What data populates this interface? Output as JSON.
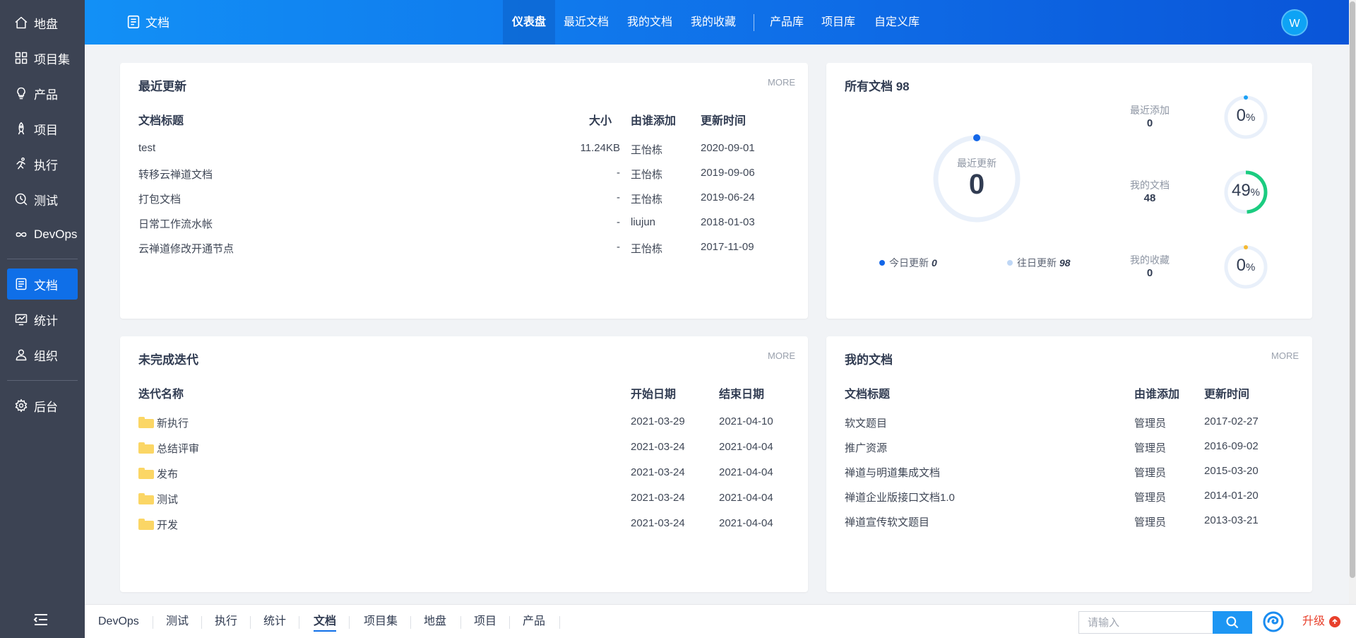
{
  "sidebar": {
    "items": [
      {
        "label": "地盘",
        "icon": "home-icon"
      },
      {
        "label": "项目集",
        "icon": "grid-icon"
      },
      {
        "label": "产品",
        "icon": "bulb-icon"
      },
      {
        "label": "项目",
        "icon": "rocket-icon"
      },
      {
        "label": "执行",
        "icon": "run-icon"
      },
      {
        "label": "测试",
        "icon": "test-icon"
      },
      {
        "label": "DevOps",
        "icon": "infinity-icon"
      },
      {
        "label": "文档",
        "icon": "doc-icon"
      },
      {
        "label": "统计",
        "icon": "chart-icon"
      },
      {
        "label": "组织",
        "icon": "user-icon"
      },
      {
        "label": "后台",
        "icon": "gear-icon"
      }
    ],
    "active": "文档"
  },
  "header": {
    "title": "文档",
    "nav": [
      "仪表盘",
      "最近文档",
      "我的文档",
      "我的收藏",
      "产品库",
      "项目库",
      "自定义库"
    ],
    "active_nav": "仪表盘",
    "avatar": "W"
  },
  "recent": {
    "title": "最近更新",
    "more": "MORE",
    "headers": {
      "title": "文档标题",
      "size": "大小",
      "added_by": "由谁添加",
      "updated": "更新时间"
    },
    "rows": [
      {
        "title": "test",
        "size": "11.24KB",
        "added_by": "王怡栋",
        "updated": "2020-09-01"
      },
      {
        "title": "转移云禅道文档",
        "size": "-",
        "added_by": "王怡栋",
        "updated": "2019-09-06"
      },
      {
        "title": "打包文档",
        "size": "-",
        "added_by": "王怡栋",
        "updated": "2019-06-24"
      },
      {
        "title": "日常工作流水帐",
        "size": "-",
        "added_by": "liujun",
        "updated": "2018-01-03"
      },
      {
        "title": "云禅道修改开通节点",
        "size": "-",
        "added_by": "王怡栋",
        "updated": "2017-11-09"
      }
    ]
  },
  "all_docs": {
    "title": "所有文档 98",
    "center_label": "最近更新",
    "center_value": "0",
    "legend": [
      {
        "label": "今日更新",
        "value": "0",
        "color": "#1366e8"
      },
      {
        "label": "往日更新",
        "value": "98",
        "color": "#bfd7f5"
      }
    ],
    "stats": [
      {
        "label": "最近添加",
        "value": "0",
        "percent": 0,
        "percent_text": "0",
        "color": "#1aa0f5"
      },
      {
        "label": "我的文档",
        "value": "48",
        "percent": 49,
        "percent_text": "49",
        "color": "#1bcc80"
      },
      {
        "label": "我的收藏",
        "value": "0",
        "percent": 0,
        "percent_text": "0",
        "color": "#f5b931"
      }
    ],
    "percent_unit": "%"
  },
  "iterations": {
    "title": "未完成迭代",
    "more": "MORE",
    "headers": {
      "name": "迭代名称",
      "start": "开始日期",
      "end": "结束日期"
    },
    "rows": [
      {
        "name": "新执行",
        "start": "2021-03-29",
        "end": "2021-04-10"
      },
      {
        "name": "总结评审",
        "start": "2021-03-24",
        "end": "2021-04-04"
      },
      {
        "name": "发布",
        "start": "2021-03-24",
        "end": "2021-04-04"
      },
      {
        "name": "测试",
        "start": "2021-03-24",
        "end": "2021-04-04"
      },
      {
        "name": "开发",
        "start": "2021-03-24",
        "end": "2021-04-04"
      }
    ]
  },
  "my_docs": {
    "title": "我的文档",
    "more": "MORE",
    "headers": {
      "title": "文档标题",
      "added_by": "由谁添加",
      "updated": "更新时间"
    },
    "rows": [
      {
        "title": "软文题目",
        "added_by": "管理员",
        "updated": "2017-02-27"
      },
      {
        "title": "推广资源",
        "added_by": "管理员",
        "updated": "2016-09-02"
      },
      {
        "title": "禅道与明道集成文档",
        "added_by": "管理员",
        "updated": "2015-03-20"
      },
      {
        "title": "禅道企业版接口文档1.0",
        "added_by": "管理员",
        "updated": "2014-01-20"
      },
      {
        "title": "禅道宣传软文题目",
        "added_by": "管理员",
        "updated": "2013-03-21"
      }
    ]
  },
  "bottombar": {
    "tabs": [
      "DevOps",
      "测试",
      "执行",
      "统计",
      "文档",
      "项目集",
      "地盘",
      "项目",
      "产品"
    ],
    "active_tab": "文档",
    "search_placeholder": "请输入",
    "upgrade": "升级"
  }
}
